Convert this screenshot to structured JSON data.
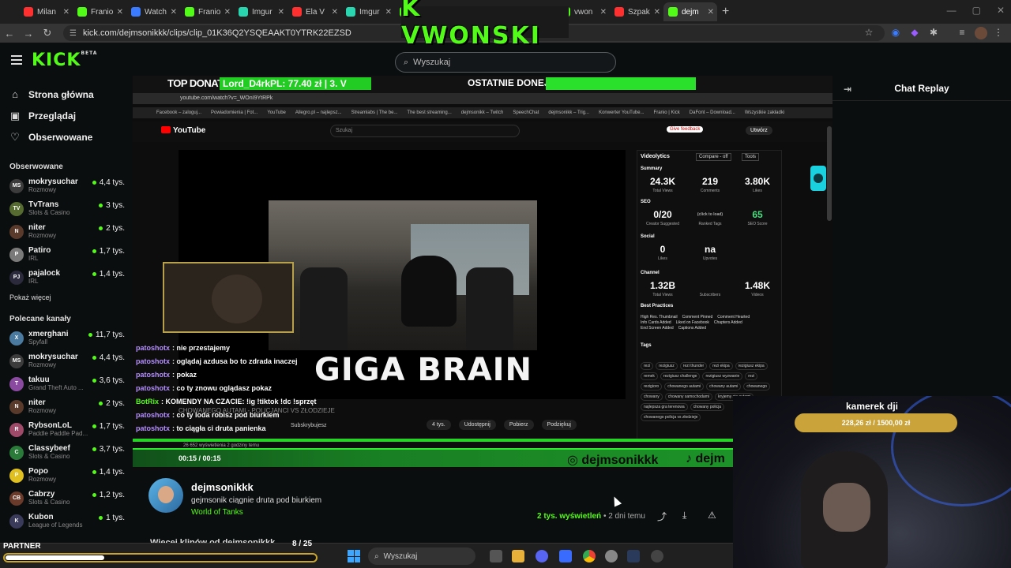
{
  "browser": {
    "tabs": [
      {
        "label": "Milan",
        "color": "#ff3030"
      },
      {
        "label": "Franio",
        "color": "#53fc18"
      },
      {
        "label": "Watch",
        "color": "#3a7bff"
      },
      {
        "label": "Franio",
        "color": "#53fc18"
      },
      {
        "label": "Imgur",
        "color": "#2ad6b0"
      },
      {
        "label": "Ela V",
        "color": "#ff3030"
      },
      {
        "label": "Imgur",
        "color": "#2ad6b0"
      },
      {
        "label": "Franio",
        "color": "#53fc18"
      },
      {
        "label": "Azdus",
        "color": "#53fc18"
      },
      {
        "label": "Franio",
        "color": "#53fc18"
      },
      {
        "label": "vwon",
        "color": "#53fc18"
      },
      {
        "label": "Szpak",
        "color": "#ff3030"
      },
      {
        "label": "dejm",
        "color": "#53fc18",
        "active": true
      }
    ],
    "url": "kick.com/dejmsonikkk/clips/clip_01K36Q2YSQEAAKT0YTRK22EZSD"
  },
  "stream_overlay": {
    "logo_text": "K VWONSKI",
    "top_donate_label": "TOP DONATE",
    "top_donate_value": "Lord_D4rkPL: 77.40 zł  |  3. V",
    "last_donates_label": "OSTATNIE DONEJTY"
  },
  "header": {
    "logo": "KICK",
    "logo_badge": "BETA",
    "search_placeholder": "Wyszukaj"
  },
  "sidebar": {
    "nav": [
      {
        "label": "Strona główna",
        "icon": "home-icon",
        "glyph": "⌂"
      },
      {
        "label": "Przeglądaj",
        "icon": "browse-icon",
        "glyph": "▣"
      },
      {
        "label": "Obserwowane",
        "icon": "heart-icon",
        "glyph": "♡"
      }
    ],
    "followed_title": "Obserwowane",
    "followed": [
      {
        "name": "mokrysuchar",
        "category": "Rozmowy",
        "viewers": "4,4 tys.",
        "color": "#3c3c3c",
        "initials": "MS"
      },
      {
        "name": "TvTrans",
        "category": "Slots & Casino",
        "viewers": "3 tys.",
        "color": "#556b2f",
        "initials": "TV"
      },
      {
        "name": "niter",
        "category": "Rozmowy",
        "viewers": "2 tys.",
        "color": "#5a3a2a",
        "initials": "N"
      },
      {
        "name": "Patiro",
        "category": "IRL",
        "viewers": "1,7 tys.",
        "color": "#7a7a7a",
        "initials": "P"
      },
      {
        "name": "pajalock",
        "category": "IRL",
        "viewers": "1,4 tys.",
        "color": "#2a2a3c",
        "initials": "PJ"
      }
    ],
    "show_more": "Pokaż więcej",
    "recommended_title": "Polecane kanały",
    "recommended": [
      {
        "name": "xmerghani",
        "category": "Spyfall",
        "viewers": "11,7 tys.",
        "color": "#4a7aa0",
        "initials": "X"
      },
      {
        "name": "mokrysuchar",
        "category": "Rozmowy",
        "viewers": "4,4 tys.",
        "color": "#3c3c3c",
        "initials": "MS"
      },
      {
        "name": "takuu",
        "category": "Grand Theft Auto ...",
        "viewers": "3,6 tys.",
        "color": "#8a4aa0",
        "initials": "T"
      },
      {
        "name": "niter",
        "category": "Rozmowy",
        "viewers": "2 tys.",
        "color": "#5a3a2a",
        "initials": "N"
      },
      {
        "name": "RybsonLoL",
        "category": "Paddle Paddle Pad...",
        "viewers": "1,7 tys.",
        "color": "#a04a6a",
        "initials": "R"
      },
      {
        "name": "Classybeef",
        "category": "Slots & Casino",
        "viewers": "3,7 tys.",
        "color": "#2a7a3a",
        "initials": "C"
      },
      {
        "name": "Popo",
        "category": "Rozmowy",
        "viewers": "1,4 tys.",
        "color": "#e0c020",
        "initials": "P"
      },
      {
        "name": "Cabrzy",
        "category": "Slots & Casino",
        "viewers": "1,2 tys.",
        "color": "#6a3a2a",
        "initials": "CB"
      },
      {
        "name": "Kubon",
        "category": "League of Legends",
        "viewers": "1 tys.",
        "color": "#3a3a5a",
        "initials": "K"
      }
    ]
  },
  "embedded": {
    "inner_url": "youtube.com/watch?v=_WOnI9YtRPk",
    "bookmarks": [
      "Facebook – zaloguj...",
      "Powiadomienia | Fot...",
      "YouTube",
      "Allegro.pl – najlepsz...",
      "Streamlabs | The be...",
      "The best streaming...",
      "dejmsonikk – Twitch",
      "SpeechChat",
      "dejmsonikk – Trig...",
      "Konwerter YouTube...",
      "Franio | Kick",
      "DaFont – Download...",
      "Wszystkie zakładki"
    ],
    "yt_logo": "YouTube",
    "yt_search_placeholder": "Szukaj",
    "yt_create": "Utwórz",
    "yt_feedback": "Give feedback",
    "video_caption": "GIGA BRAIN",
    "video_title_partial": "CHOWANEGO AUTAMI - POLICJANCI VS ZŁODZIEJE",
    "views_line": "26 652 wyświetlenia  2 godziny temu",
    "actions": [
      "4 tys.",
      "Udostępnij",
      "Pobierz",
      "Podziękuj"
    ],
    "subscribe": "Subskrybujesz",
    "timecode": "00:15 / 00:15",
    "instagram": "dejmsonikkk",
    "tiktok": "dejm"
  },
  "videolytics": {
    "title": "Videolytics",
    "compare": "Compare - off",
    "tools": "Tools",
    "summary_label": "Summary",
    "summary": [
      {
        "value": "24.3K",
        "label": "Total Views"
      },
      {
        "value": "219",
        "label": "Comments"
      },
      {
        "value": "3.80K",
        "label": "Likes"
      }
    ],
    "seo_label": "SEO",
    "seo": [
      {
        "value": "0/20",
        "label": "Creator Suggested"
      },
      {
        "value": "(click to load)",
        "label": "Ranked Tags"
      },
      {
        "value": "65",
        "label": "SEO Score"
      }
    ],
    "social_label": "Social",
    "social": [
      {
        "value": "0",
        "label": "Likes"
      },
      {
        "value": "na",
        "label": "Upvotes"
      }
    ],
    "channel_label": "Channel",
    "channel": [
      {
        "value": "1.32B",
        "label": "Total Views"
      },
      {
        "value": "",
        "label": "Subscribers"
      },
      {
        "value": "1.48K",
        "label": "Videos"
      }
    ],
    "best_practices_label": "Best Practices",
    "best_practices": [
      "High Res. Thumbnail",
      "Comment Pinned",
      "Comment Hearted",
      "Info Cards Added",
      "Liked on Facebook",
      "Chapters Added",
      "End Screen Added",
      "Captions Added"
    ],
    "tags_label": "Tags",
    "tags": [
      "rezi",
      "rezigiusz",
      "rezi thunder",
      "rezi ekipa",
      "rezigiusz ekipa",
      "remek",
      "rezigiusz challenge",
      "rezigiusz wyzwanie",
      "rezi",
      "rezigioro",
      "chowanego autami",
      "chowany autami",
      "chowanego",
      "chowany",
      "chowany samochodami",
      "kryjemy się autami",
      "najlepsza gra terenowa",
      "chowany policja",
      "chowanego policja vs złodzieje"
    ]
  },
  "chat_overlay": [
    {
      "user": "patoshotx",
      "text": "nie przestajemy"
    },
    {
      "user": "patoshotx",
      "text": "oglądaj azdusa bo to zdrada inaczej"
    },
    {
      "user": "patoshotx",
      "text": "pokaz"
    },
    {
      "user": "patoshotx",
      "text": "co ty znowu oglądasz pokaz"
    },
    {
      "user": "BotRix",
      "text": "KOMENDY NA CZACIE: !ig !tiktok !dc !sprzęt",
      "bot": true
    },
    {
      "user": "patoshotx",
      "text": "co ty loda robisz pod biurkiem"
    },
    {
      "user": "patoshotx",
      "text": "to ciągła ci druta panienka"
    }
  ],
  "chat_panel": {
    "title": "Chat Replay"
  },
  "facecam": {
    "goal_title": "kamerek dji",
    "goal_progress": "228,26 zł / 1500,00 zł",
    "goal_fraction": 0.152
  },
  "clip": {
    "streamer": "dejmsonikkk",
    "title": "gejmsonik ciągnie druta pod biurkiem",
    "category": "World of Tanks",
    "views": "2 tys. wyświetleń",
    "age": "• 2 dni temu",
    "more_from": "Więcej klipów od dejmsonikkk",
    "pager": "8  /  25"
  },
  "taskbar": {
    "partner_label": "PARTNER",
    "partner_fraction": 0.32,
    "search_placeholder": "Wyszukaj"
  }
}
